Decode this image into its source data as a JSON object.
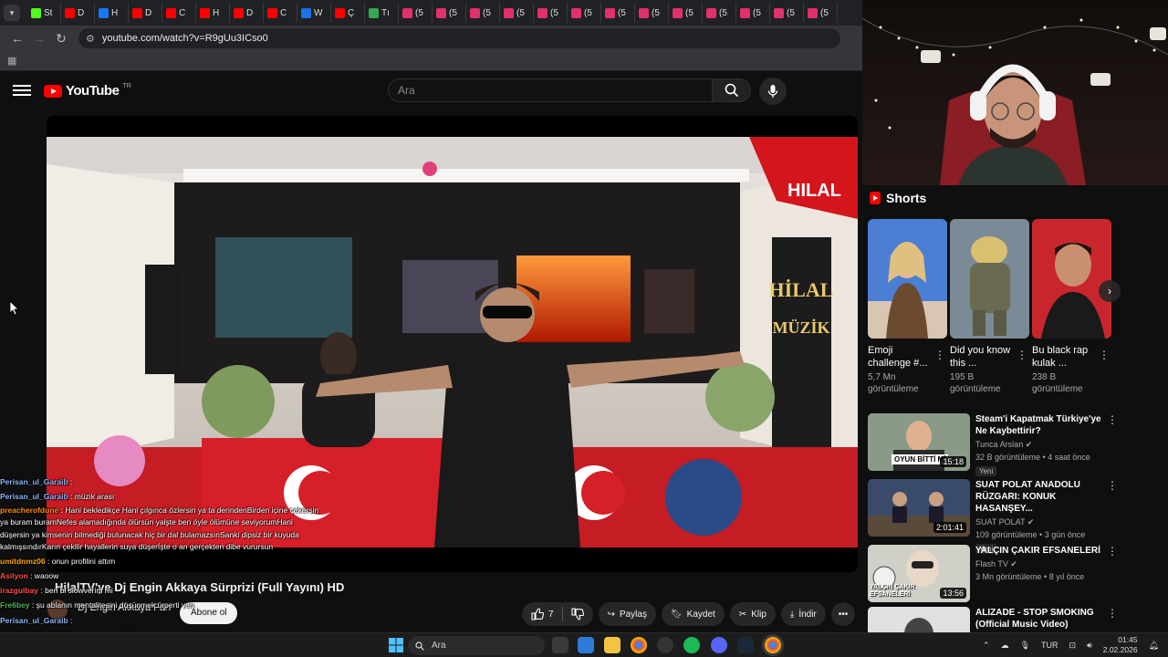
{
  "browser": {
    "tabs": [
      {
        "label": "St",
        "icon": "kick-icon",
        "color": "#53fc18"
      },
      {
        "label": "D",
        "icon": "youtube-icon",
        "color": "#ff0000"
      },
      {
        "label": "H",
        "icon": "facebook-icon",
        "color": "#1877f2"
      },
      {
        "label": "D",
        "icon": "youtube-icon",
        "color": "#ff0000"
      },
      {
        "label": "C",
        "icon": "youtube-icon",
        "color": "#ff0000"
      },
      {
        "label": "H",
        "icon": "youtube-icon",
        "color": "#ff0000"
      },
      {
        "label": "D",
        "icon": "youtube-icon",
        "color": "#ff0000"
      },
      {
        "label": "C",
        "icon": "youtube-icon",
        "color": "#ff0000"
      },
      {
        "label": "W",
        "icon": "web-icon",
        "color": "#1a73e8"
      },
      {
        "label": "Ç",
        "icon": "youtube-icon",
        "color": "#ff0000"
      },
      {
        "label": "Tı",
        "icon": "web-icon",
        "color": "#34a853"
      },
      {
        "label": "(5",
        "icon": "instagram-icon",
        "color": "#e1306c"
      },
      {
        "label": "(5",
        "icon": "instagram-icon",
        "color": "#e1306c"
      },
      {
        "label": "(5",
        "icon": "instagram-icon",
        "color": "#e1306c"
      },
      {
        "label": "(5",
        "icon": "instagram-icon",
        "color": "#e1306c"
      },
      {
        "label": "(5",
        "icon": "instagram-icon",
        "color": "#e1306c"
      },
      {
        "label": "(5",
        "icon": "instagram-icon",
        "color": "#e1306c"
      },
      {
        "label": "(5",
        "icon": "instagram-icon",
        "color": "#e1306c"
      },
      {
        "label": "(5",
        "icon": "instagram-icon",
        "color": "#e1306c"
      },
      {
        "label": "(5",
        "icon": "instagram-icon",
        "color": "#e1306c"
      },
      {
        "label": "(5",
        "icon": "instagram-icon",
        "color": "#e1306c"
      },
      {
        "label": "(5",
        "icon": "instagram-icon",
        "color": "#e1306c"
      },
      {
        "label": "(5",
        "icon": "instagram-icon",
        "color": "#e1306c"
      },
      {
        "label": "(5",
        "icon": "instagram-icon",
        "color": "#e1306c"
      }
    ],
    "url": "youtube.com/watch?v=R9gUu3ICso0"
  },
  "youtube": {
    "logo_text": "YouTube",
    "country_code": "TR",
    "search_placeholder": "Ara"
  },
  "video": {
    "title": "HilalTV'ye Dj Engin Akkaya Sürprizi (Full Yayını) HD",
    "channel": "Dj Engin Akkaya Fan",
    "subscribe_label": "Abone ol",
    "likes": "7",
    "share_label": "Paylaş",
    "save_label": "Kaydet",
    "clip_label": "Klip",
    "download_label": "İndir",
    "overlay_logo": "HILAL"
  },
  "shorts": {
    "header": "Shorts",
    "items": [
      {
        "title": "Emoji challenge #...",
        "views": "5,7 Mn",
        "views_unit": "görüntüleme"
      },
      {
        "title": "Did you know this ...",
        "views": "195 B",
        "views_unit": "görüntüleme"
      },
      {
        "title": "Bu black rap kulak ...",
        "views": "238 B",
        "views_unit": "görüntüleme"
      }
    ]
  },
  "recommendations": [
    {
      "title": "Steam'i Kapatmak Türkiye'ye Ne Kaybettirir?",
      "channel": "Tunca Arslan",
      "meta": "32 B görüntüleme • 4 saat önce",
      "badge": "Yeni",
      "duration": "15:18",
      "thumb_text": "OYUN BİTTİ Mİ"
    },
    {
      "title": "SUAT POLAT ANADOLU RÜZGARI: KONUK HASANŞEY...",
      "channel": "SUAT POLAT",
      "meta": "109 görüntüleme • 3 gün önce",
      "badge": "Yeni",
      "duration": "2:01:41",
      "thumb_text": ""
    },
    {
      "title": "YALÇIN ÇAKIR EFSANELERİ",
      "channel": "Flash TV",
      "meta": "3 Mn görüntüleme • 8 yıl önce",
      "badge": "",
      "duration": "13:56",
      "thumb_text": "YALÇIN ÇAKIR EFSANELERİ"
    },
    {
      "title": "ALIZADE - STOP SMOKING (Official Music Video)",
      "channel": "",
      "meta": "",
      "badge": "",
      "duration": "",
      "thumb_text": ""
    }
  ],
  "chat": [
    {
      "user": "Perisan_ul_Garaib",
      "user_color": "#8ab4f8",
      "text": ":"
    },
    {
      "user": "Perisan_ul_Garaib",
      "user_color": "#8ab4f8",
      "text": ": müzik arası"
    },
    {
      "user": "preacherofdune",
      "user_color": "#ff8c00",
      "text": ": Hani bekledikçe Hani çılgınca özlersin ya ta derindenBirden içine çekersin ya buram buramNefes alamadığında ölürsün yalşte ben öyle ölümüne seviyorumHani düşersin ya kimsenin bilmediği bulunacak hiç bir dal bulamazsınSanki dipsiz bir kuyuda kalmışsındırKarın çekilir hayallerin suya düşerİşte o an gerçekten dibe vurursun"
    },
    {
      "user": "umitdnmz06",
      "user_color": "#ffa500",
      "text": ": onun profilini attım"
    },
    {
      "user": "Asilyon",
      "user_color": "#ff4d4d",
      "text": ": waoow"
    },
    {
      "user": "irazgulbay",
      "user_color": "#ff4d4d",
      "text": ": ben bi slowverim mi"
    },
    {
      "user": "Fre6bey",
      "user_color": "#4caf50",
      "text": ": şu ablanın mentalitesini düşünmek ürperti veri"
    },
    {
      "user": "Perisan_ul_Garaib",
      "user_color": "#8ab4f8",
      "text": ":"
    },
    {
      "user": "preacherofdune",
      "user_color": "#ff8c00",
      "text": ": Kitaptan bir şiir ahhhha"
    }
  ],
  "taskbar": {
    "search_placeholder": "Ara",
    "language": "TUR",
    "time": "01:45",
    "date": "2.02.2026"
  }
}
